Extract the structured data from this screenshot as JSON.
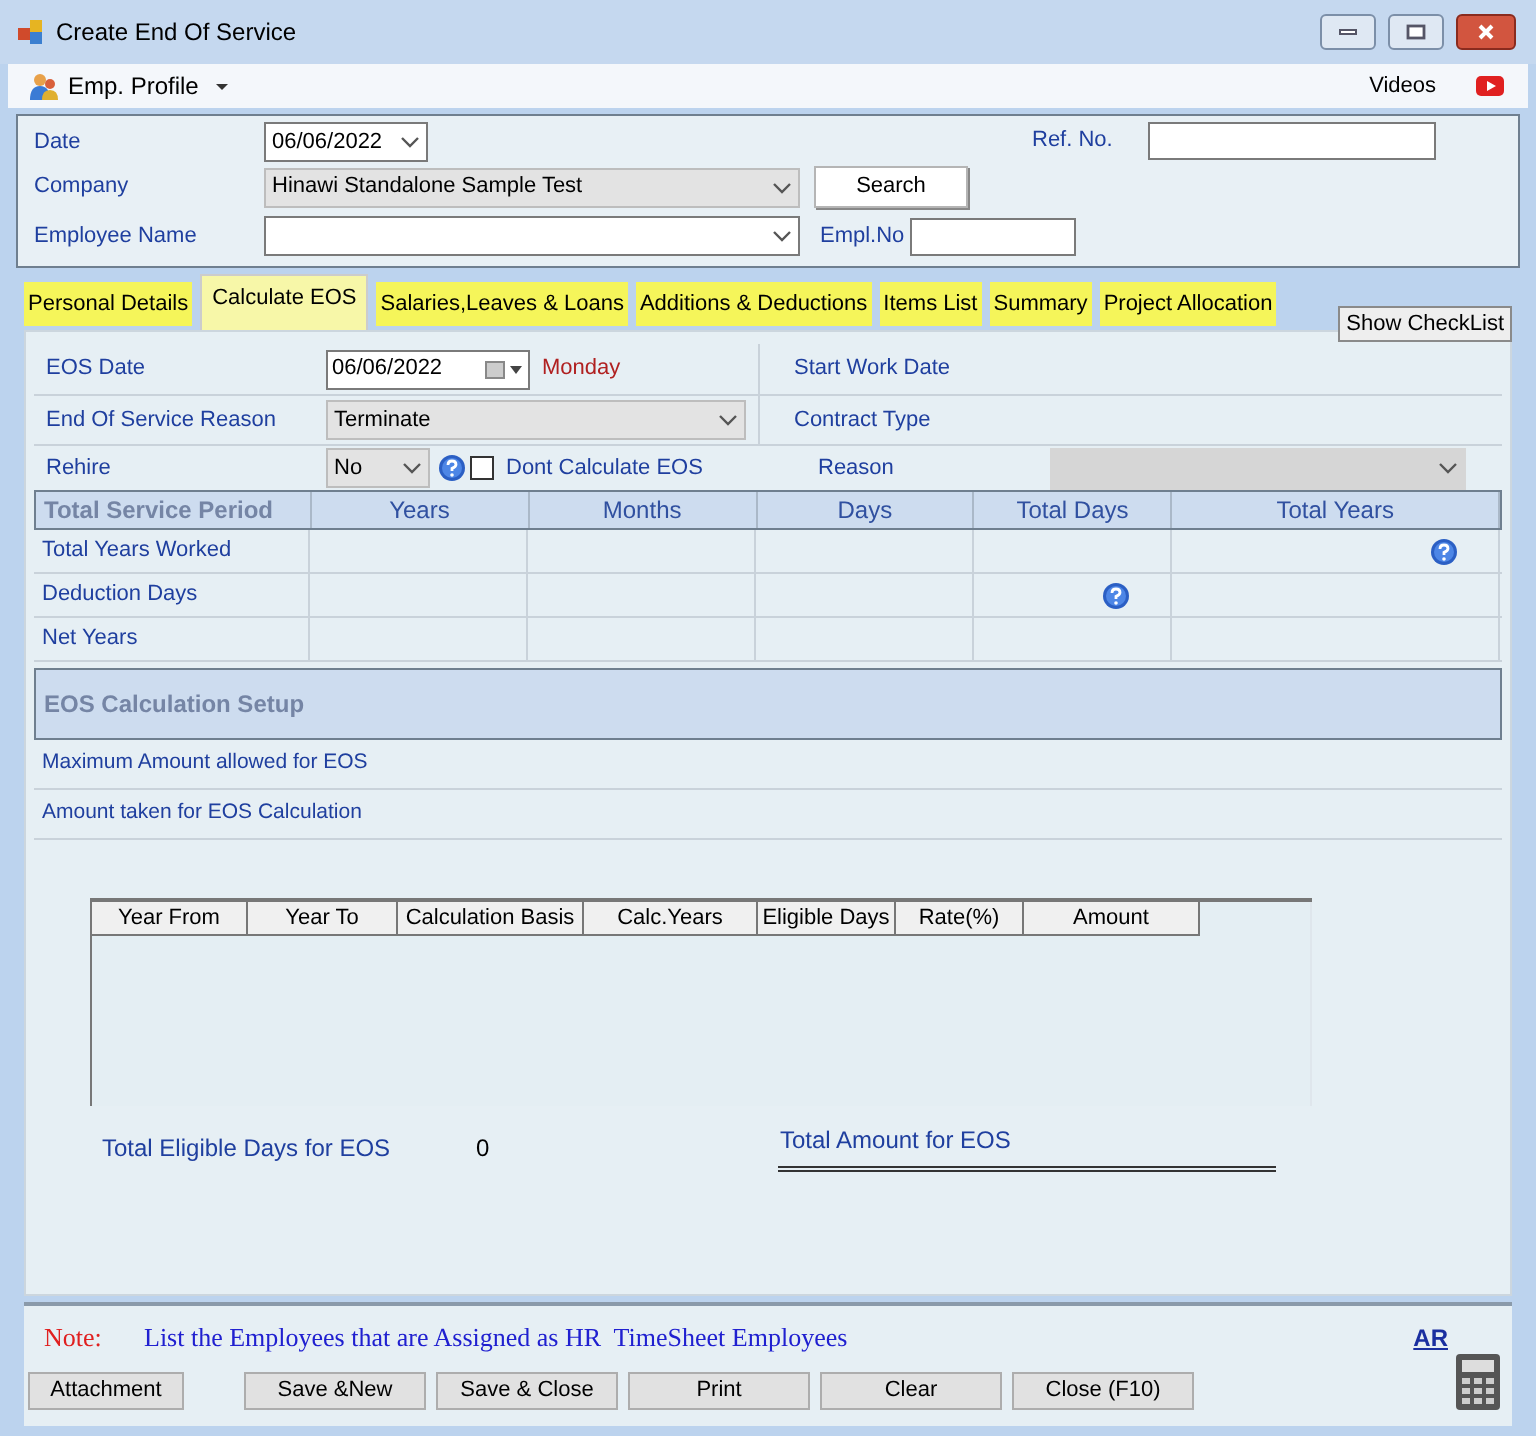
{
  "window": {
    "title": "Create End Of Service"
  },
  "toolbar": {
    "profile_menu": "Emp. Profile",
    "videos": "Videos"
  },
  "header": {
    "date": {
      "label": "Date",
      "value": "06/06/2022"
    },
    "ref_no": {
      "label": "Ref. No."
    },
    "company": {
      "label": "Company",
      "value": "Hinawi Standalone Sample Test"
    },
    "search_button": "Search",
    "employee_name": {
      "label": "Employee Name"
    },
    "empl_no": {
      "label": "Empl.No"
    }
  },
  "tabs": [
    {
      "label": "Personal Details",
      "selected": false
    },
    {
      "label": "Calculate EOS",
      "selected": true
    },
    {
      "label": "Salaries,Leaves & Loans",
      "selected": false
    },
    {
      "label": "Additions & Deductions",
      "selected": false
    },
    {
      "label": "Items List",
      "selected": false
    },
    {
      "label": "Summary",
      "selected": false
    },
    {
      "label": "Project Allocation",
      "selected": false
    }
  ],
  "checklist_button": "Show CheckList",
  "eos_form": {
    "eos_date": {
      "label": "EOS Date",
      "value": "06/06/2022",
      "day": "Monday"
    },
    "reason": {
      "label": "End Of Service Reason",
      "value": "Terminate"
    },
    "rehire": {
      "label": "Rehire",
      "value": "No"
    },
    "dont_calculate": {
      "label": "Dont Calculate EOS",
      "checked": false
    },
    "start_work_date": {
      "label": "Start Work Date"
    },
    "contract_type": {
      "label": "Contract Type"
    },
    "reason_field": {
      "label": "Reason",
      "disabled": true
    }
  },
  "service_table": {
    "columns": [
      "Total Service Period",
      "Years",
      "Months",
      "Days",
      "Total Days",
      "Total Years"
    ],
    "rows": [
      {
        "label": "Total Years Worked",
        "help": [
          false,
          false,
          false,
          false,
          true
        ]
      },
      {
        "label": "Deduction Days",
        "help": [
          false,
          false,
          false,
          true,
          false
        ]
      },
      {
        "label": "Net Years",
        "help": [
          false,
          false,
          false,
          false,
          false
        ]
      }
    ]
  },
  "setup": {
    "title": "EOS Calculation Setup",
    "lines": [
      "Maximum Amount allowed for EOS",
      "Amount taken for EOS Calculation"
    ]
  },
  "calc_table": {
    "columns": [
      "Year From",
      "Year To",
      "Calculation Basis",
      "Calc.Years",
      "Eligible Days",
      "Rate(%)",
      "Amount"
    ]
  },
  "totals": {
    "eligible_label": "Total Eligible Days for EOS",
    "eligible_value": "0",
    "amount_label": "Total Amount for EOS"
  },
  "note": {
    "label": "Note:",
    "text": "List the Employees that are Assigned as HR  TimeSheet Employees",
    "link": "AR"
  },
  "buttons": [
    {
      "label": "Attachment"
    },
    {
      "label": "Save &New"
    },
    {
      "label": "Save & Close"
    },
    {
      "label": "Print"
    },
    {
      "label": "Clear"
    },
    {
      "label": "Close (F10)"
    }
  ]
}
